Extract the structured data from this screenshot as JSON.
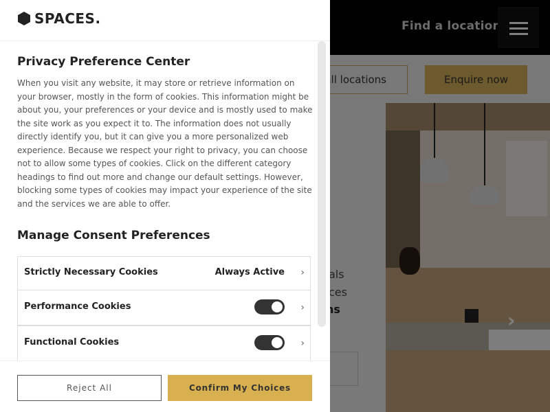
{
  "brand": {
    "logo_text": "SPACES."
  },
  "site": {
    "find_location": "Find a location",
    "menu_icon": "hamburger-icon",
    "all_locations_fragment": "all locations",
    "enquire": "Enquire now",
    "fragments": [
      "als",
      "ces",
      "ns"
    ]
  },
  "privacy": {
    "title": "Privacy Preference Center",
    "description": "When you visit any website, it may store or retrieve information on your browser, mostly in the form of cookies. This information might be about you, your preferences or your device and is mostly used to make the site work as you expect it to. The information does not usually directly identify you, but it can give you a more personalized web experience. Because we respect your right to privacy, you can choose not to allow some types of cookies. Click on the different category headings to find out more and change our default settings. However, blocking some types of cookies may impact your experience of the site and the services we are able to offer.",
    "manage_title": "Manage Consent Preferences",
    "categories": [
      {
        "label": "Strictly Necessary Cookies",
        "status": "Always Active"
      },
      {
        "label": "Performance Cookies",
        "enabled": true
      },
      {
        "label": "Functional Cookies",
        "enabled": true
      }
    ],
    "reject_label": "Reject All",
    "confirm_label": "Confirm My Choices"
  },
  "colors": {
    "accent": "#d9b04f",
    "header_bg": "#000000",
    "toggle_on": "#333333"
  }
}
